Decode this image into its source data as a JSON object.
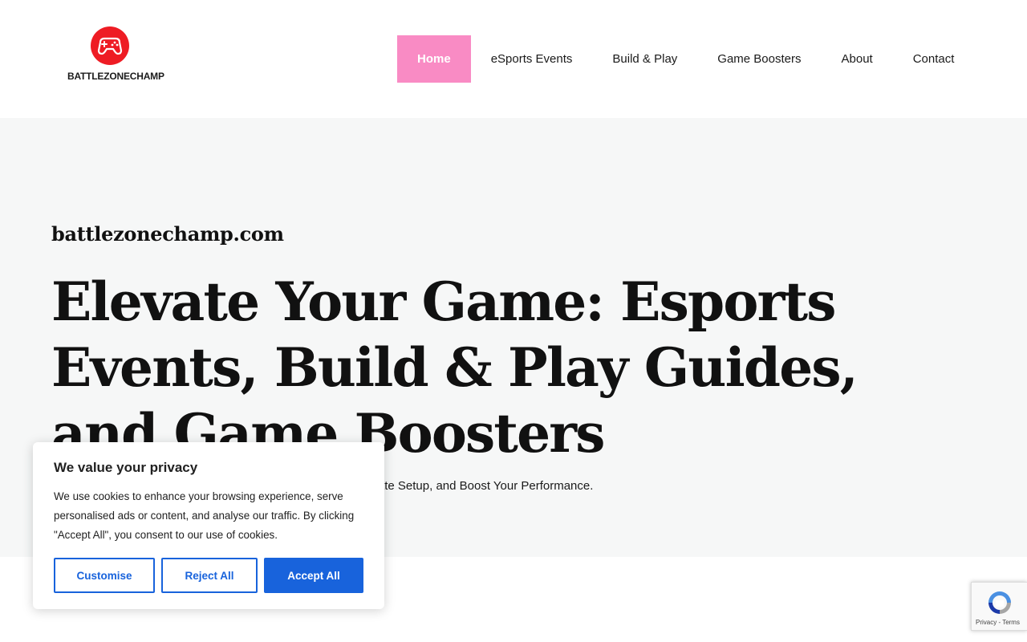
{
  "header": {
    "logo_text": "BATTLEZONECHAMP",
    "logo_icon": "gamepad-icon",
    "brand_color": "#ee1c24"
  },
  "nav": {
    "items": [
      {
        "label": "Home",
        "active": true
      },
      {
        "label": "eSports Events",
        "active": false
      },
      {
        "label": "Build & Play",
        "active": false
      },
      {
        "label": "Game Boosters",
        "active": false
      },
      {
        "label": "About",
        "active": false
      },
      {
        "label": "Contact",
        "active": false
      }
    ],
    "active_color": "#f98bc4"
  },
  "hero": {
    "site_name": "battlezonechamp.com",
    "title": "Elevate Your Game: Esports Events, Build & Play Guides, and Game Boosters",
    "subtitle": "Stay Ahead with the Latest Esports Updates, Build Your Ultimate Setup, and Boost Your Performance."
  },
  "cookie_banner": {
    "title": "We value your privacy",
    "text": "We use cookies to enhance your browsing experience, serve personalised ads or content, and analyse our traffic. By clicking \"Accept All\", you consent to our use of cookies.",
    "customise_label": "Customise",
    "reject_label": "Reject All",
    "accept_label": "Accept All",
    "accent_color": "#1863dc"
  },
  "recaptcha": {
    "links": "Privacy - Terms",
    "icon": "recaptcha-icon"
  }
}
